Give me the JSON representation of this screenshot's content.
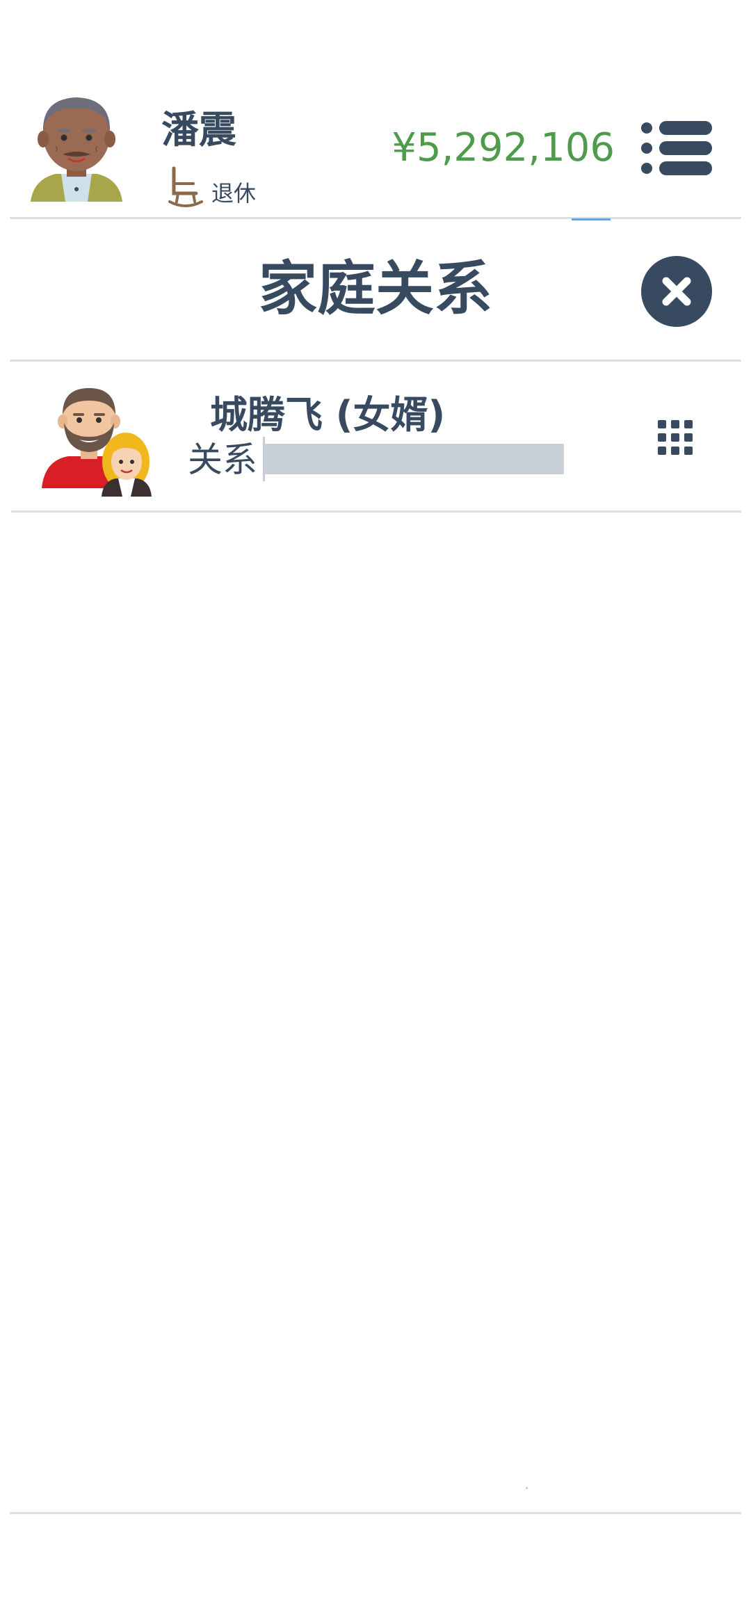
{
  "header": {
    "player_name": "潘震",
    "status_icon": "rocking-chair-icon",
    "status_text": "退休",
    "money": "¥5,292,106",
    "money_color": "#4e9c4b",
    "menu_icon": "list-menu-icon"
  },
  "panel": {
    "title": "家庭关系",
    "close_icon": "close-icon"
  },
  "relatives": [
    {
      "name": "城腾飞 (女婿)",
      "relation_label": "关系",
      "relation_level": 0,
      "avatar_icon": "couple-avatar-icon",
      "actions_icon": "grid-menu-icon"
    }
  ],
  "colors": {
    "text": "#384a60",
    "money": "#4e9c4b",
    "divider": "#dcdfe4",
    "bar_empty": "#c9d0d8"
  }
}
